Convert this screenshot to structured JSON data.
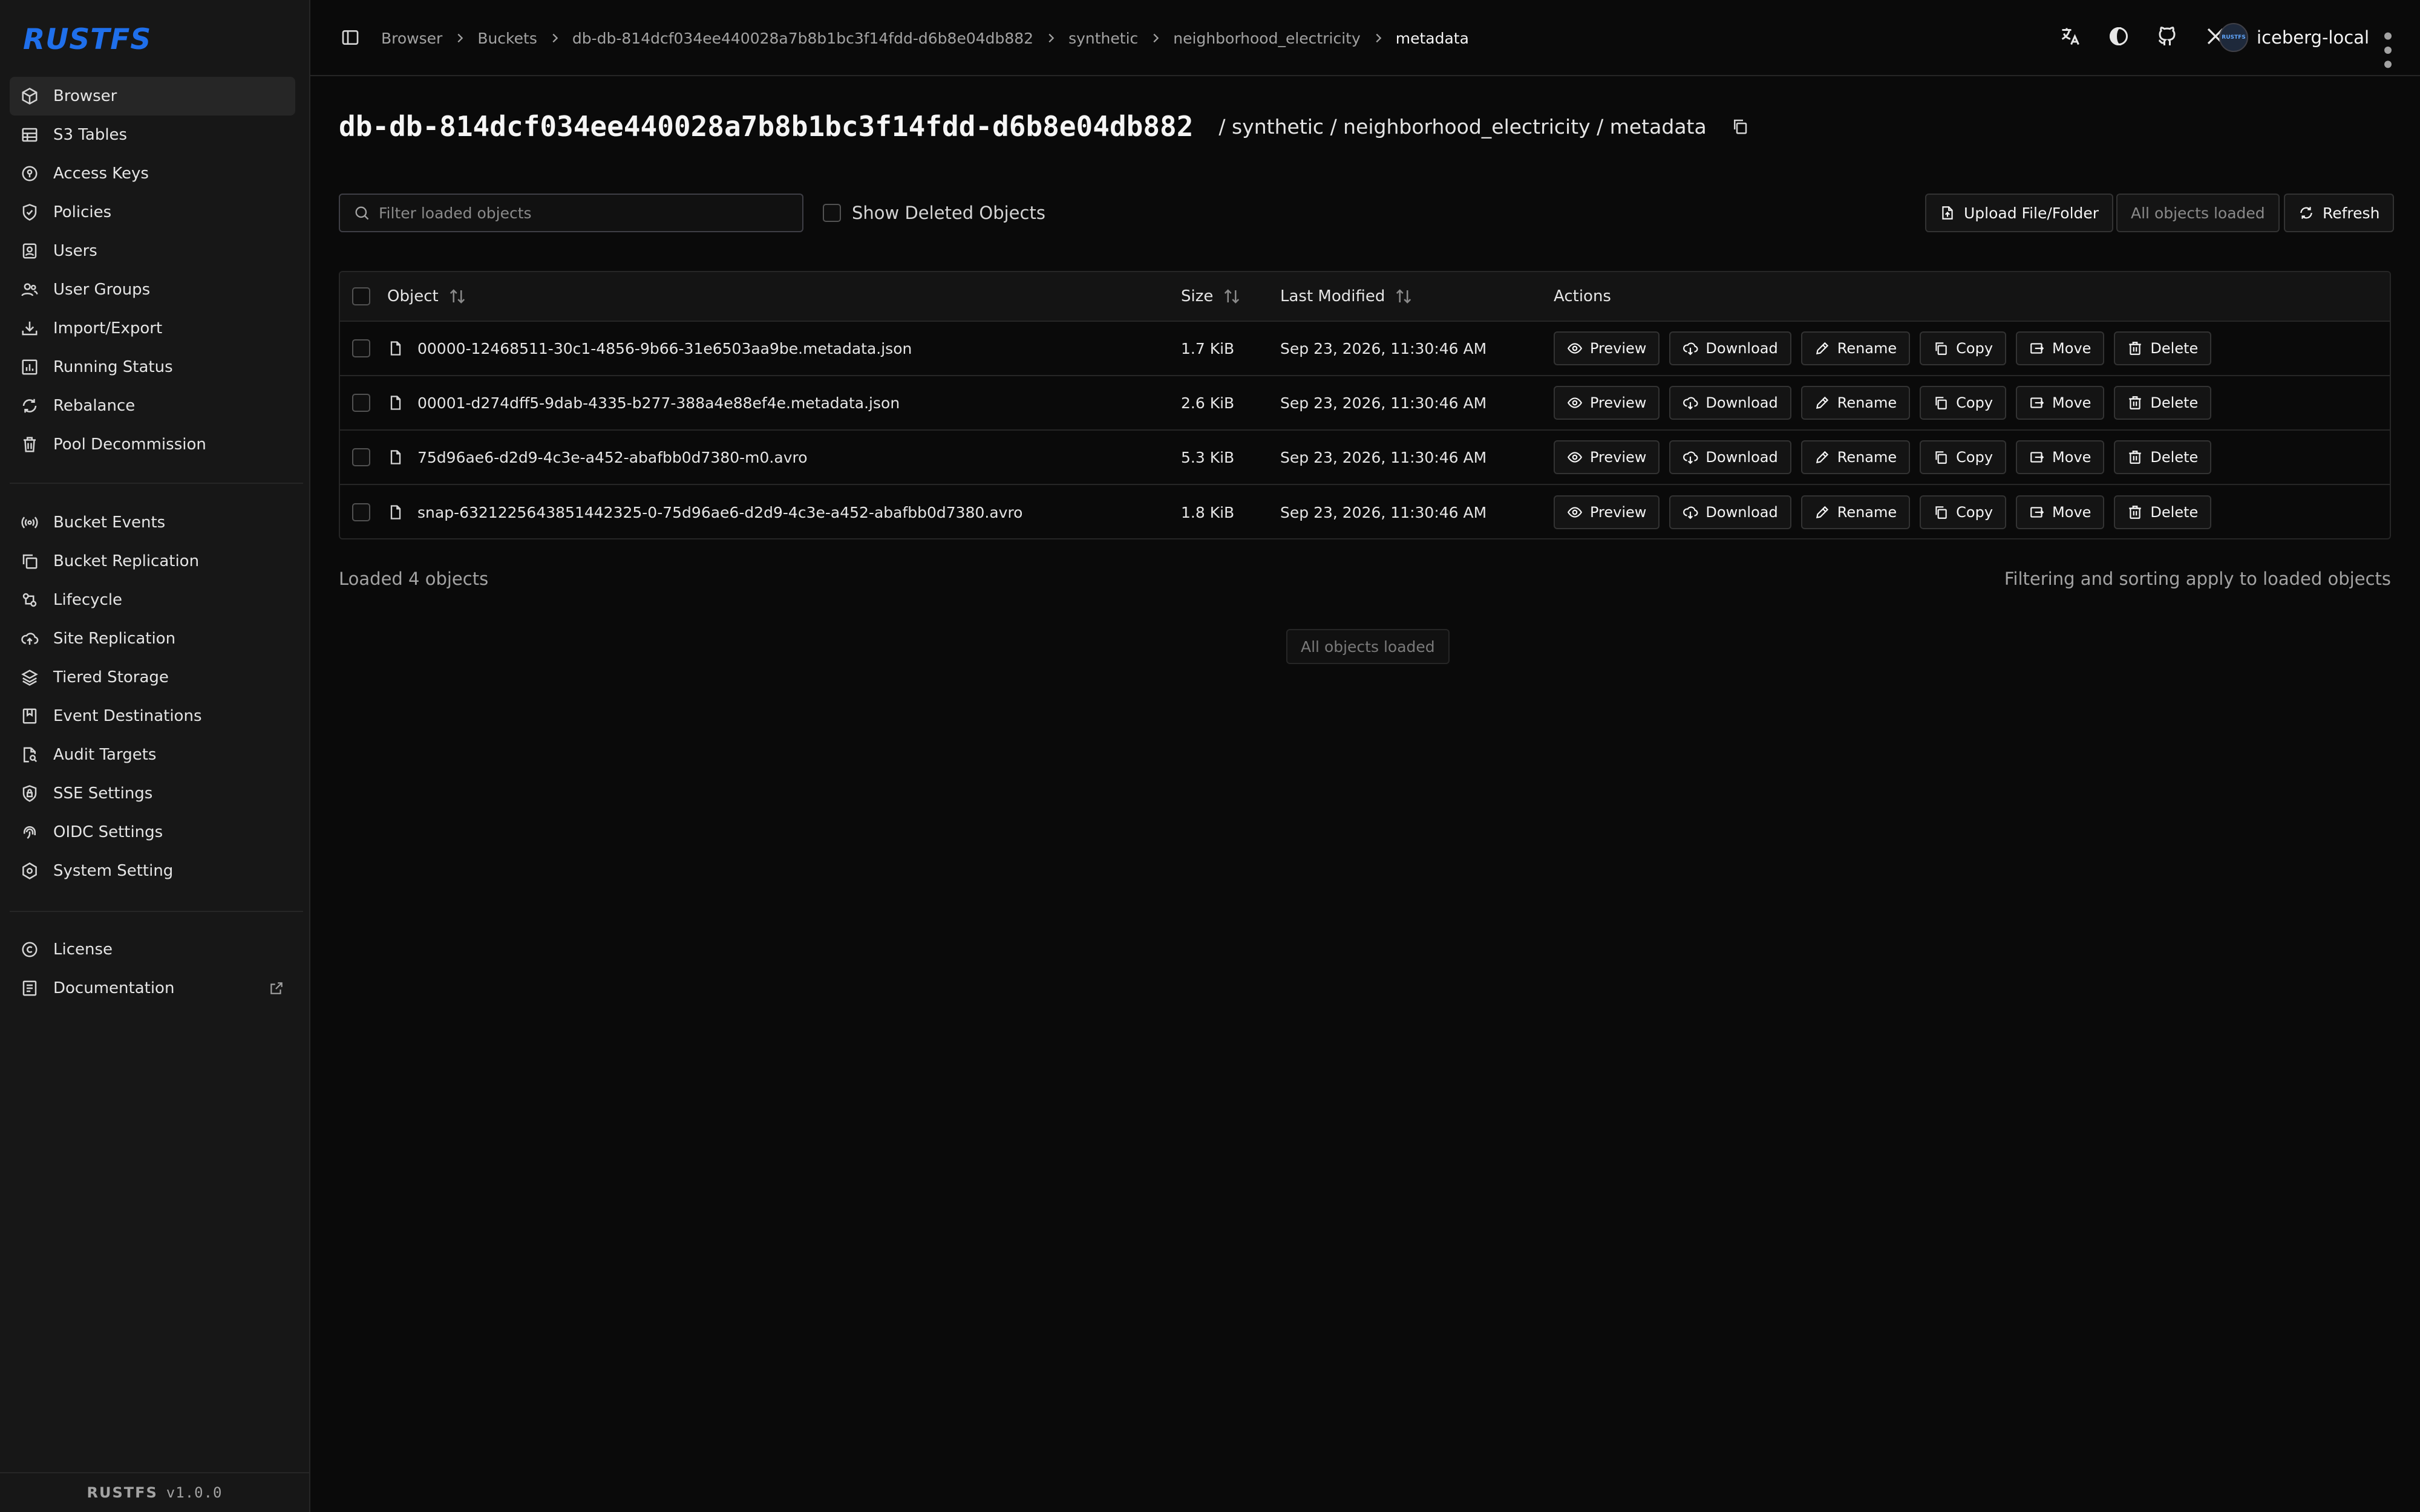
{
  "brand": {
    "logo_text": "RUSTFS",
    "footer_name": "RUSTFS",
    "version": "v1.0.0",
    "accent": "#1f6feb"
  },
  "sidebar": {
    "main": [
      {
        "label": "Browser",
        "icon": "cube-icon",
        "active": true
      },
      {
        "label": "S3 Tables",
        "icon": "table-icon"
      },
      {
        "label": "Access Keys",
        "icon": "key-icon"
      },
      {
        "label": "Policies",
        "icon": "shield-icon"
      },
      {
        "label": "Users",
        "icon": "user-icon"
      },
      {
        "label": "User Groups",
        "icon": "users-icon"
      },
      {
        "label": "Import/Export",
        "icon": "download-tray-icon"
      },
      {
        "label": "Running Status",
        "icon": "bar-chart-icon"
      },
      {
        "label": "Rebalance",
        "icon": "refresh-icon"
      },
      {
        "label": "Pool Decommission",
        "icon": "trash-icon"
      }
    ],
    "secondary": [
      {
        "label": "Bucket Events",
        "icon": "broadcast-icon"
      },
      {
        "label": "Bucket Replication",
        "icon": "copy-icon"
      },
      {
        "label": "Lifecycle",
        "icon": "lifecycle-icon"
      },
      {
        "label": "Site Replication",
        "icon": "cloud-upload-icon"
      },
      {
        "label": "Tiered Storage",
        "icon": "layers-icon"
      },
      {
        "label": "Event Destinations",
        "icon": "bookmark-icon"
      },
      {
        "label": "Audit Targets",
        "icon": "file-search-icon"
      },
      {
        "label": "SSE Settings",
        "icon": "lock-shield-icon"
      },
      {
        "label": "OIDC Settings",
        "icon": "fingerprint-icon"
      },
      {
        "label": "System Setting",
        "icon": "settings-icon"
      }
    ],
    "tertiary": [
      {
        "label": "License",
        "icon": "copyright-icon"
      },
      {
        "label": "Documentation",
        "icon": "document-icon"
      }
    ]
  },
  "topbar": {
    "breadcrumbs": [
      "Browser",
      "Buckets",
      "db-db-814dcf034ee440028a7b8b1bc3f14fdd-d6b8e04db882",
      "synthetic",
      "neighborhood_electricity",
      "metadata"
    ],
    "user_name": "iceberg-local",
    "avatar_text": "RUSTFS"
  },
  "page": {
    "bucket": "db-db-814dcf034ee440028a7b8b1bc3f14fdd-d6b8e04db882",
    "path": "/ synthetic / neighborhood_electricity / metadata"
  },
  "toolbar": {
    "filter_placeholder": "Filter loaded objects",
    "show_deleted_label": "Show Deleted Objects",
    "upload_label": "Upload File/Folder",
    "all_loaded_label": "All objects loaded",
    "refresh_label": "Refresh"
  },
  "table": {
    "headers": {
      "object": "Object",
      "size": "Size",
      "modified": "Last Modified",
      "actions": "Actions"
    },
    "action_labels": {
      "preview": "Preview",
      "download": "Download",
      "rename": "Rename",
      "copy": "Copy",
      "move": "Move",
      "delete": "Delete"
    },
    "rows": [
      {
        "name": "00000-12468511-30c1-4856-9b66-31e6503aa9be.metadata.json",
        "size": "1.7 KiB",
        "modified": "Sep 23, 2026, 11:30:46 AM"
      },
      {
        "name": "00001-d274dff5-9dab-4335-b277-388a4e88ef4e.metadata.json",
        "size": "2.6 KiB",
        "modified": "Sep 23, 2026, 11:30:46 AM"
      },
      {
        "name": "75d96ae6-d2d9-4c3e-a452-abafbb0d7380-m0.avro",
        "size": "5.3 KiB",
        "modified": "Sep 23, 2026, 11:30:46 AM"
      },
      {
        "name": "snap-6321225643851442325-0-75d96ae6-d2d9-4c3e-a452-abafbb0d7380.avro",
        "size": "1.8 KiB",
        "modified": "Sep 23, 2026, 11:30:46 AM"
      }
    ]
  },
  "status": {
    "loaded_count": "Loaded 4 objects",
    "filter_note": "Filtering and sorting apply to loaded objects",
    "all_loaded": "All objects loaded"
  }
}
